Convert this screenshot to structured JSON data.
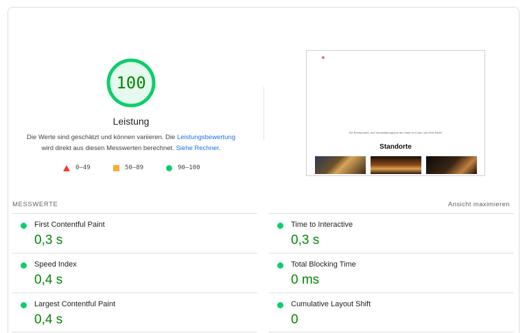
{
  "score": {
    "value": "100",
    "fraction": 1.0,
    "title": "Leistung",
    "color": "#0cce6b",
    "text_color": "#008800"
  },
  "description": {
    "part1": "Die Werte sind geschätzt und können variieren. Die ",
    "link1": "Leistungsbewertung",
    "part2": " wird direkt aus diesen Messwerten berechnet. ",
    "link2": "Siehe Rechner",
    "part3": "."
  },
  "legend": [
    {
      "shape": "triangle-icon",
      "color": "#ff3333",
      "label": "0–49"
    },
    {
      "shape": "square-icon",
      "color": "#ffaa33",
      "label": "50–89"
    },
    {
      "shape": "circle-icon",
      "color": "#0cce6b",
      "label": "90–100"
    }
  ],
  "thumbnail": {
    "caption": "Die Restaurants- und Veranstaltungsorte der Hotel für Kultur und Erbe Berlin",
    "heading": "Standorte"
  },
  "metrics_section": {
    "label": "MESSWERTE",
    "expand_label": "Ansicht maximieren"
  },
  "metrics": [
    {
      "name": "First Contentful Paint",
      "value": "0,3 s"
    },
    {
      "name": "Time to Interactive",
      "value": "0,3 s"
    },
    {
      "name": "Speed Index",
      "value": "0,4 s"
    },
    {
      "name": "Total Blocking Time",
      "value": "0 ms"
    },
    {
      "name": "Largest Contentful Paint",
      "value": "0,4 s"
    },
    {
      "name": "Cumulative Layout Shift",
      "value": "0"
    }
  ]
}
